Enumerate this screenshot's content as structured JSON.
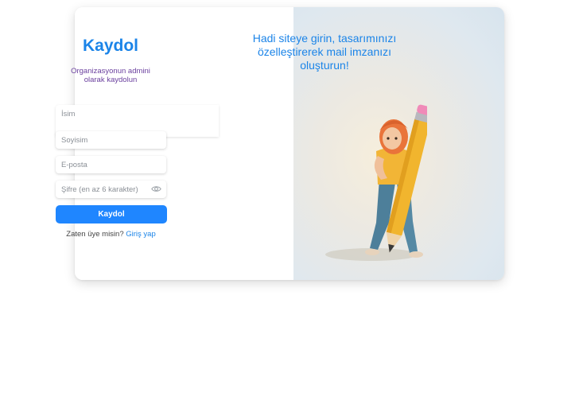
{
  "signup": {
    "title": "Kaydol",
    "subtitle": "Organizasyonun admini olarak kaydolun",
    "fields": {
      "first_name_placeholder": "İsim",
      "last_name_placeholder": "Soyisim",
      "email_placeholder": "E-posta",
      "password_placeholder": "Şifre (en az 6 karakter)"
    },
    "submit_label": "Kaydol",
    "already_member_text": "Zaten üye misin?",
    "login_link_label": "Giriş yap"
  },
  "promo": {
    "headline": "Hadi siteye girin, tasarımınızı özelleştirerek mail imzanızı oluşturun!"
  },
  "icons": {
    "password_toggle": "eye-icon",
    "illustration": "girl-with-pencil-illustration"
  },
  "colors": {
    "accent": "#1b84e8",
    "button": "#1f86ff",
    "subtitle": "#6a3f9e"
  }
}
